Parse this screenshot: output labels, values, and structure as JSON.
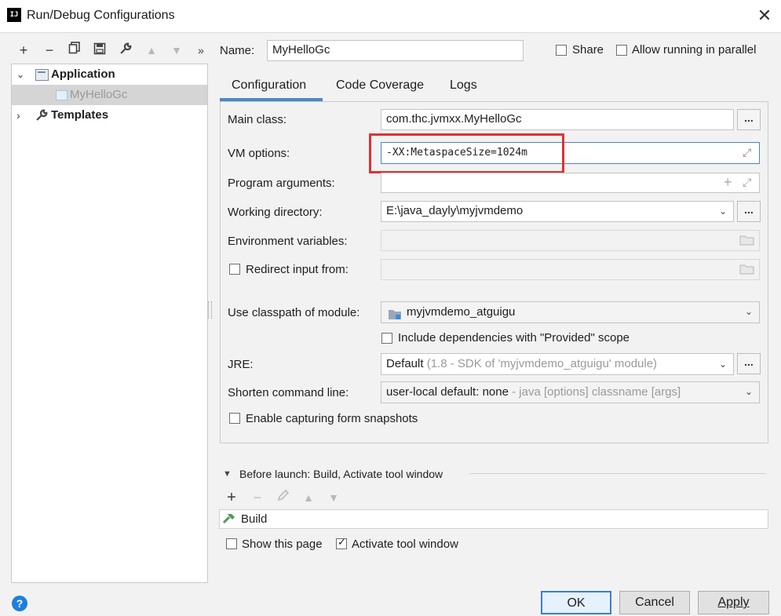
{
  "window": {
    "title": "Run/Debug Configurations",
    "app_icon_text": "IJ"
  },
  "toolbar": {
    "add": "+",
    "remove": "−",
    "copy": "⧉",
    "save": "▣",
    "wrench": "🔧",
    "up": "▲",
    "down": "▼",
    "more": "»"
  },
  "tree": {
    "application_label": "Application",
    "config_label": "MyHelloGc",
    "templates_label": "Templates"
  },
  "header": {
    "name_label": "Name:",
    "name_value": "MyHelloGc",
    "share_label": "Share",
    "parallel_label": "Allow running in parallel"
  },
  "tabs": [
    {
      "label": "Configuration",
      "active": true
    },
    {
      "label": "Code Coverage",
      "active": false
    },
    {
      "label": "Logs",
      "active": false
    }
  ],
  "form": {
    "main_class_label": "Main class:",
    "main_class_value": "com.thc.jvmxx.MyHelloGc",
    "vm_options_label": "VM options:",
    "vm_options_value": "-XX:MetaspaceSize=1024m",
    "program_args_label": "Program arguments:",
    "working_dir_label": "Working directory:",
    "working_dir_value": "E:\\java_dayly\\myjvmdemo",
    "env_vars_label": "Environment variables:",
    "redirect_label": "Redirect input from:",
    "classpath_label": "Use classpath of module:",
    "classpath_value": "myjvmdemo_atguigu",
    "include_deps_label": "Include dependencies with \"Provided\" scope",
    "jre_label": "JRE:",
    "jre_value": "Default",
    "jre_detail": "(1.8 - SDK of 'myjvmdemo_atguigu' module)",
    "shorten_label": "Shorten command line:",
    "shorten_value": "user-local default: none",
    "shorten_detail": "- java [options] classname [args]",
    "snapshots_label": "Enable capturing form snapshots",
    "ellipsis": "..."
  },
  "before_launch": {
    "title": "Before launch: Build, Activate tool window",
    "item": "Build",
    "show_page_label": "Show this page",
    "activate_label": "Activate tool window"
  },
  "buttons": {
    "ok": "OK",
    "cancel": "Cancel",
    "apply": "Apply"
  },
  "help_icon": "?",
  "colors": {
    "accent": "#3a7fcf",
    "highlight": "#e03032",
    "tab_underline": "#4a88c7",
    "build_icon": "#4d9a52"
  }
}
